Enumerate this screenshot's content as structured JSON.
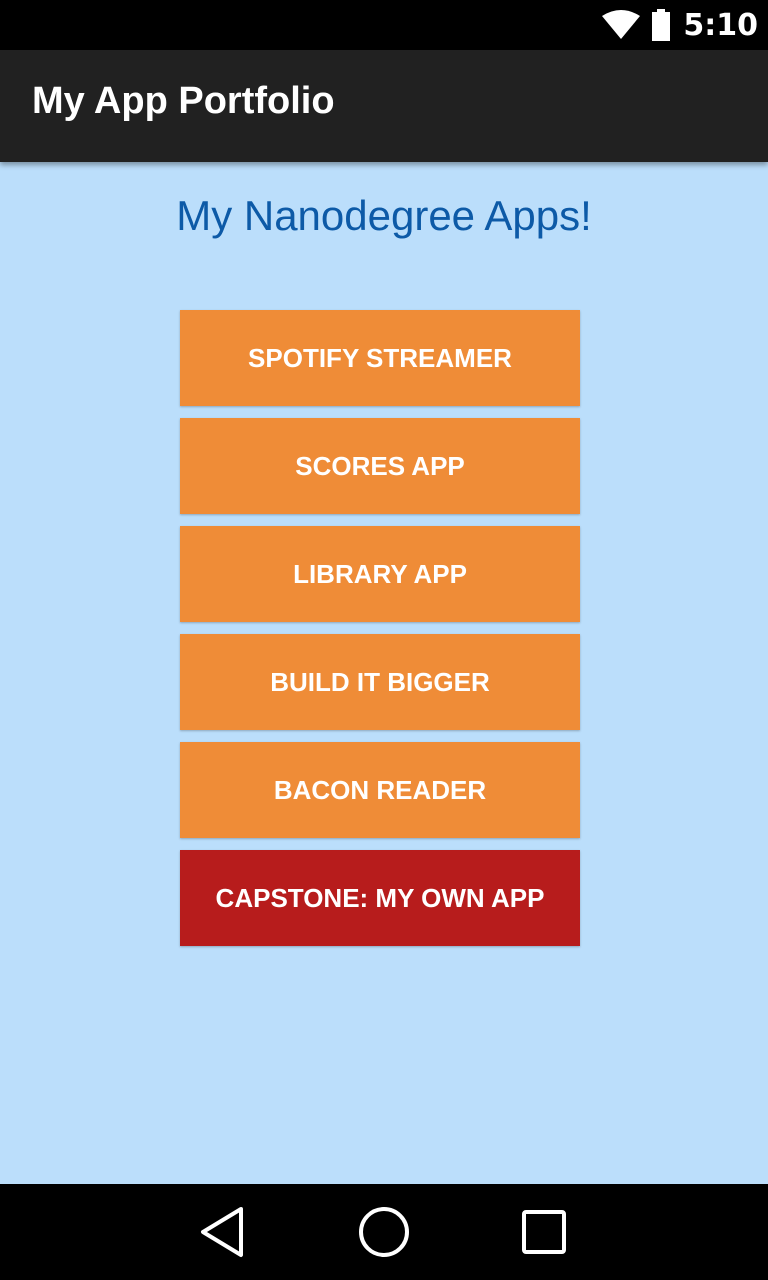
{
  "status_bar": {
    "time": "5:10",
    "icons": [
      "wifi-icon",
      "battery-icon"
    ]
  },
  "app_bar": {
    "title": "My App Portfolio"
  },
  "main": {
    "heading": "My Nanodegree Apps!",
    "buttons": [
      {
        "label": "SPOTIFY STREAMER"
      },
      {
        "label": "SCORES APP"
      },
      {
        "label": "LIBRARY APP"
      },
      {
        "label": "BUILD IT BIGGER"
      },
      {
        "label": "BACON READER"
      },
      {
        "label": "CAPSTONE: MY OWN APP"
      }
    ]
  },
  "nav_bar": {
    "icons": [
      "back-icon",
      "home-icon",
      "recents-icon"
    ]
  },
  "colors": {
    "background": "#bbdefb",
    "app_bar": "#212121",
    "heading_text": "#0d5aa7",
    "button": "#ef8c37",
    "capstone_button": "#b71c1c"
  }
}
